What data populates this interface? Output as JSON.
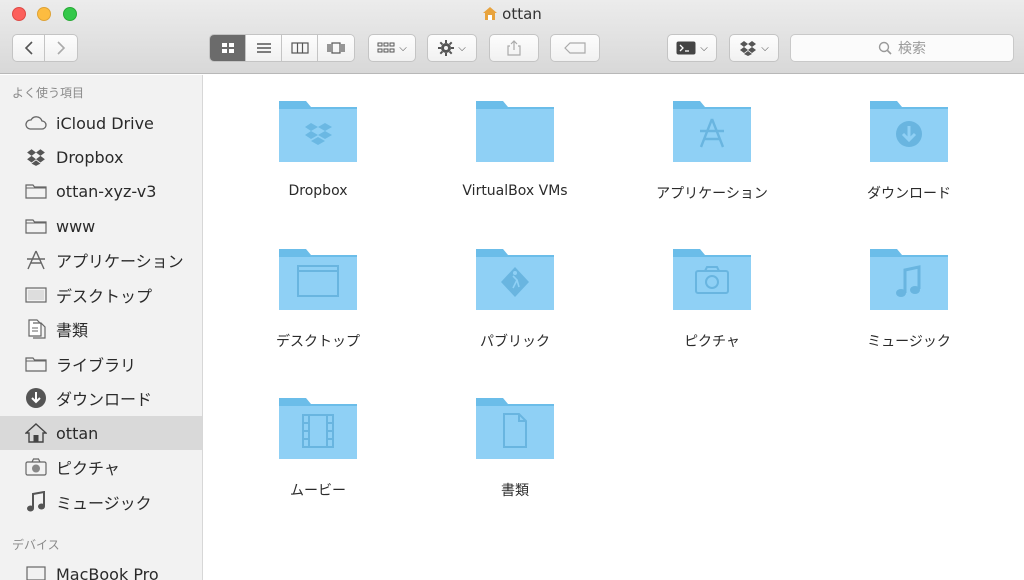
{
  "window": {
    "title": "ottan"
  },
  "toolbar": {
    "search_placeholder": "検索"
  },
  "sidebar": {
    "favorites_header": "よく使う項目",
    "devices_header": "デバイス",
    "items": [
      {
        "label": "iCloud Drive",
        "icon": "cloud-icon"
      },
      {
        "label": "Dropbox",
        "icon": "dropbox-icon"
      },
      {
        "label": "ottan-xyz-v3",
        "icon": "folder-icon"
      },
      {
        "label": "www",
        "icon": "folder-icon"
      },
      {
        "label": "アプリケーション",
        "icon": "applications-icon"
      },
      {
        "label": "デスクトップ",
        "icon": "desktop-icon"
      },
      {
        "label": "書類",
        "icon": "documents-icon"
      },
      {
        "label": "ライブラリ",
        "icon": "folder-icon"
      },
      {
        "label": "ダウンロード",
        "icon": "download-icon"
      },
      {
        "label": "ottan",
        "icon": "home-icon",
        "selected": true
      },
      {
        "label": "ピクチャ",
        "icon": "camera-icon"
      },
      {
        "label": "ミュージック",
        "icon": "music-icon"
      }
    ],
    "devices": [
      {
        "label": "MacBook Pro",
        "icon": "laptop-icon"
      }
    ]
  },
  "main": {
    "folders": [
      {
        "label": "Dropbox",
        "icon": "dropbox-folder-icon"
      },
      {
        "label": "VirtualBox VMs",
        "icon": "folder-icon"
      },
      {
        "label": "アプリケーション",
        "icon": "applications-folder-icon"
      },
      {
        "label": "ダウンロード",
        "icon": "downloads-folder-icon"
      },
      {
        "label": "デスクトップ",
        "icon": "desktop-folder-icon"
      },
      {
        "label": "パブリック",
        "icon": "public-folder-icon"
      },
      {
        "label": "ピクチャ",
        "icon": "pictures-folder-icon"
      },
      {
        "label": "ミュージック",
        "icon": "music-folder-icon"
      },
      {
        "label": "ムービー",
        "icon": "movies-folder-icon"
      },
      {
        "label": "書類",
        "icon": "documents-folder-icon"
      }
    ]
  },
  "colors": {
    "folder": "#8fd0f5",
    "folder_dark": "#6bbde9",
    "sidebar_selected": "#d9d9d9",
    "active_segment": "#6b6b6b"
  }
}
